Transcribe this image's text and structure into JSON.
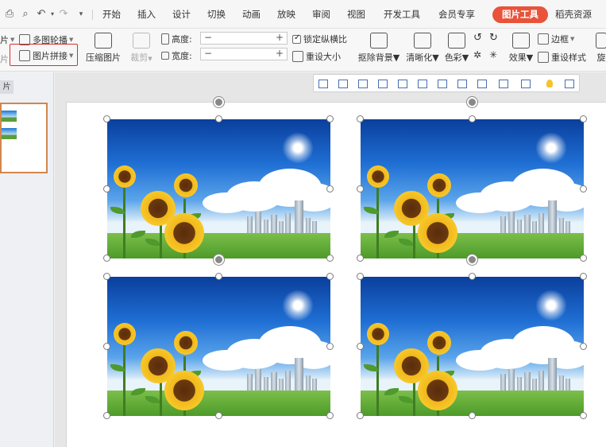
{
  "quick_access": [
    "print-icon",
    "print-preview-icon",
    "undo-icon",
    "redo-icon",
    "more-icon"
  ],
  "tabs": [
    {
      "label": "开始"
    },
    {
      "label": "插入"
    },
    {
      "label": "设计"
    },
    {
      "label": "切换"
    },
    {
      "label": "动画"
    },
    {
      "label": "放映"
    },
    {
      "label": "审阅"
    },
    {
      "label": "视图"
    },
    {
      "label": "开发工具"
    },
    {
      "label": "会员专享"
    },
    {
      "label": "图片工具",
      "active": true
    },
    {
      "label": "稻壳资源"
    }
  ],
  "ribbon": {
    "partial_left_top": "片",
    "partial_left_bottom": "片",
    "multi_carousel": "多图轮播",
    "image_collage": "图片拼接",
    "compress": "压缩图片",
    "crop": "裁剪",
    "height_label": "高度:",
    "width_label": "宽度:",
    "lock_ratio": "锁定纵横比",
    "reset_size": "重设大小",
    "remove_bg": "抠除背景",
    "sharpen": "清晰化",
    "color": "色彩",
    "effects": "效果",
    "border": "边框",
    "reset_style": "重设样式",
    "rotate_partial": "旋"
  },
  "left_panel": {
    "tab_label": "片"
  },
  "accent_colors": {
    "active_tab": "#e8533a",
    "highlight": "#d8302c",
    "thumb_border": "#d3864c"
  },
  "align_toolbar_icons": [
    "align-left-icon",
    "align-center-icon",
    "align-right-icon",
    "align-top-icon",
    "align-middle-icon",
    "align-bottom-icon",
    "distribute-horizontal-icon",
    "distribute-vertical-icon",
    "distribute-rows-icon",
    "crop-icon",
    "group-icon",
    "bulb-icon",
    "more-icon"
  ],
  "images": [
    "sunflower-photo-1",
    "sunflower-photo-2",
    "sunflower-photo-3",
    "sunflower-photo-4"
  ]
}
